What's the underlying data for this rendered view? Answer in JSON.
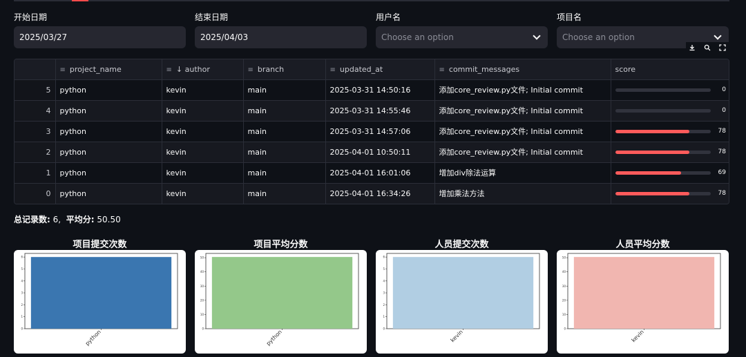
{
  "filters": [
    {
      "label": "开始日期",
      "value": "2025/03/27",
      "placeholder": false
    },
    {
      "label": "结束日期",
      "value": "2025/04/03",
      "placeholder": false
    },
    {
      "label": "用户名",
      "value": "Choose an option",
      "placeholder": true
    },
    {
      "label": "项目名",
      "value": "Choose an option",
      "placeholder": true
    }
  ],
  "toolbar": {
    "download": "download-icon",
    "search": "search-icon",
    "fullscreen": "fullscreen-icon"
  },
  "table": {
    "columns": [
      "project_name",
      "↓ author",
      "branch",
      "updated_at",
      "commit_messages",
      "score"
    ],
    "rows": [
      {
        "index": "5",
        "project_name": "python",
        "author": "kevin",
        "branch": "main",
        "updated_at": "2025-03-31 14:50:16",
        "commit_messages": "添加core_review.py文件; Initial commit",
        "score": 0
      },
      {
        "index": "4",
        "project_name": "python",
        "author": "kevin",
        "branch": "main",
        "updated_at": "2025-03-31 14:55:46",
        "commit_messages": "添加core_review.py文件; Initial commit",
        "score": 0
      },
      {
        "index": "3",
        "project_name": "python",
        "author": "kevin",
        "branch": "main",
        "updated_at": "2025-03-31 14:57:06",
        "commit_messages": "添加core_review.py文件; Initial commit",
        "score": 78
      },
      {
        "index": "2",
        "project_name": "python",
        "author": "kevin",
        "branch": "main",
        "updated_at": "2025-04-01 10:50:11",
        "commit_messages": "添加core_review.py文件; Initial commit",
        "score": 78
      },
      {
        "index": "1",
        "project_name": "python",
        "author": "kevin",
        "branch": "main",
        "updated_at": "2025-04-01 16:01:06",
        "commit_messages": "增加div除法运算",
        "score": 69
      },
      {
        "index": "0",
        "project_name": "python",
        "author": "kevin",
        "branch": "main",
        "updated_at": "2025-04-01 16:34:26",
        "commit_messages": "增加乘法方法",
        "score": 78
      }
    ],
    "score_max": 100,
    "score_bar_color": "#ff5b5b"
  },
  "summary": {
    "count_label": "总记录数:",
    "count_value": "6,",
    "avg_label": "平均分:",
    "avg_value": "50.50"
  },
  "chart_data": [
    {
      "type": "bar",
      "title": "项目提交次数",
      "categories": [
        "python"
      ],
      "values": [
        6
      ],
      "ylim": [
        0,
        6.3
      ],
      "yticks": [
        "0",
        "1",
        "2",
        "3",
        "4",
        "5",
        "6"
      ],
      "color": "#3a76b0"
    },
    {
      "type": "bar",
      "title": "项目平均分数",
      "categories": [
        "python"
      ],
      "values": [
        50.5
      ],
      "ylim": [
        0,
        53
      ],
      "yticks": [
        "0",
        "10",
        "20",
        "30",
        "40",
        "50"
      ],
      "color": "#94c88a"
    },
    {
      "type": "bar",
      "title": "人员提交次数",
      "categories": [
        "kevin"
      ],
      "values": [
        6
      ],
      "ylim": [
        0,
        6.3
      ],
      "yticks": [
        "0",
        "1",
        "2",
        "3",
        "4",
        "5",
        "6"
      ],
      "color": "#b1cee3"
    },
    {
      "type": "bar",
      "title": "人员平均分数",
      "categories": [
        "kevin"
      ],
      "values": [
        50.5
      ],
      "ylim": [
        0,
        53
      ],
      "yticks": [
        "0",
        "10",
        "20",
        "30",
        "40",
        "50"
      ],
      "color": "#f1b6b0"
    }
  ]
}
